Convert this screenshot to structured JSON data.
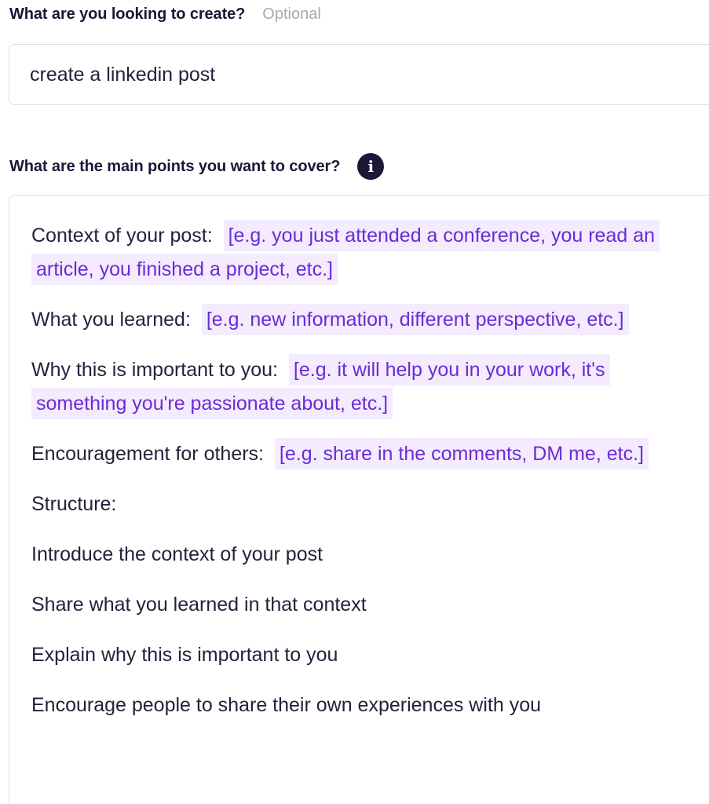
{
  "question1": {
    "label": "What are you looking to create?",
    "optional": "Optional",
    "value": "create a linkedin post"
  },
  "question2": {
    "label": "What are the main points you want to cover?",
    "info_icon_glyph": "i",
    "items": [
      {
        "prefix": "Context of your post:",
        "placeholder": "[e.g. you just attended a conference, you read an article, you finished a project, etc.]"
      },
      {
        "prefix": "What you learned:",
        "placeholder": "[e.g. new information, different perspective, etc.]"
      },
      {
        "prefix": "Why this is important to you:",
        "placeholder": "[e.g. it will help you in your work, it's something you're passionate about, etc.]"
      },
      {
        "prefix": "Encouragement for others:",
        "placeholder": "[e.g. share in the comments, DM me, etc.]"
      }
    ],
    "lines": [
      "Structure:",
      "Introduce the context of your post",
      "Share what you learned in that context",
      "Explain why this is important to you",
      "Encourage people to share their own experiences with you"
    ]
  },
  "colors": {
    "label": "#1d1637",
    "optional": "#a9a8b1",
    "placeholder_text": "#6a2bd6",
    "placeholder_bg": "#f4ebfe",
    "border": "#dddbe3"
  },
  "icons": [
    "info-icon"
  ]
}
